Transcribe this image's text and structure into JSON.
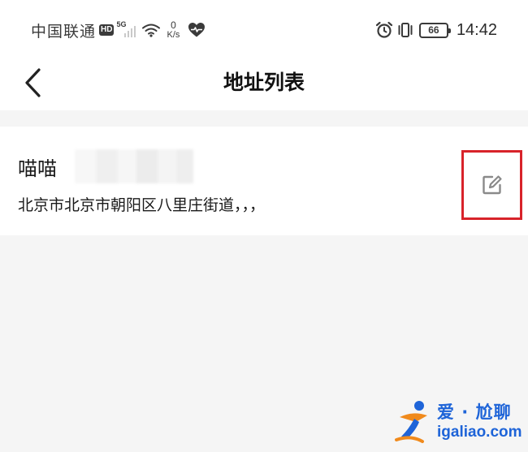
{
  "status_bar": {
    "carrier": "中国联通",
    "hd_badge": "HD",
    "network_type": "5G",
    "net_speed_value": "0",
    "net_speed_unit": "K/s",
    "battery_level": "66",
    "time": "14:42",
    "icons": [
      "signal-icon",
      "wifi-icon",
      "heart-icon",
      "alarm-icon",
      "vibrate-icon",
      "battery-icon"
    ]
  },
  "nav": {
    "title": "地址列表",
    "back_icon": "chevron-left-icon"
  },
  "address_list": [
    {
      "name": "喵喵",
      "address": "北京市北京市朝阳区八里庄街道，，，",
      "edit_icon": "edit-icon"
    }
  ],
  "watermark": {
    "cn_text": "爱 · 尬聊",
    "url": "igaliao.com"
  },
  "colors": {
    "background": "#f5f5f5",
    "surface": "#ffffff",
    "highlight_border": "#d8232a",
    "watermark_blue": "#1e64d8",
    "watermark_orange": "#f08a1c"
  }
}
